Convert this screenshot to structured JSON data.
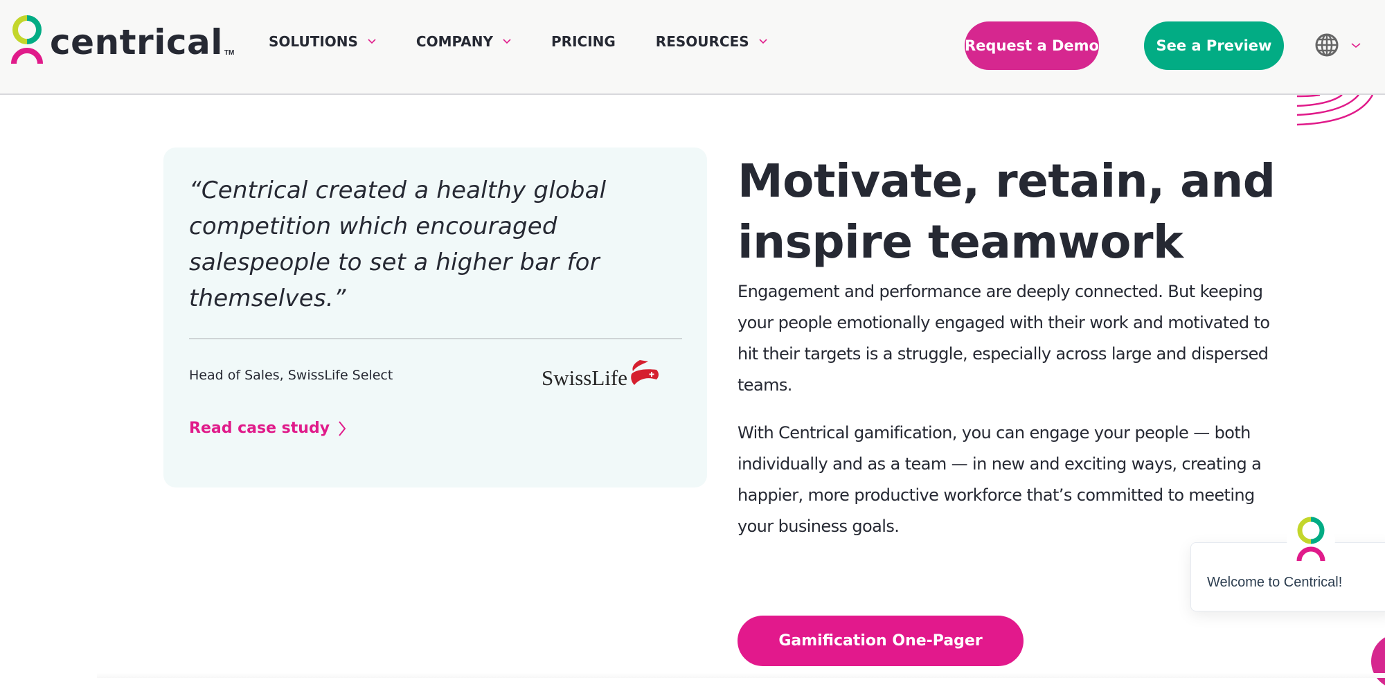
{
  "brand": {
    "name": "centrical",
    "trademark": "TM",
    "colors": {
      "pink": "#e01b8a",
      "green": "#02ac84",
      "lime": "#c3d62b",
      "dark": "#262933",
      "card_bg": "#f1f9f9"
    }
  },
  "nav": {
    "items": [
      {
        "label": "SOLUTIONS",
        "has_dropdown": true
      },
      {
        "label": "COMPANY",
        "has_dropdown": true
      },
      {
        "label": "PRICING",
        "has_dropdown": false
      },
      {
        "label": "RESOURCES",
        "has_dropdown": true
      }
    ],
    "request_demo_label": "Request a Demo",
    "see_preview_label": "See a Preview",
    "language_icon": "globe-icon"
  },
  "testimonial": {
    "quote": "“Centrical created a healthy global competition which encouraged salespeople to set a higher bar for themselves.”",
    "attribution": "Head of Sales, SwissLife Select",
    "company_logo_text": "SwissLife",
    "link_label": "Read case study"
  },
  "main": {
    "headline": "Motivate, retain, and inspire teamwork",
    "paragraphs": [
      "Engagement and performance are deeply connected. But keeping your people emotionally engaged with their work and motivated to hit their targets is a struggle, especially across large and dispersed teams.",
      "With Centrical gamification, you can engage your people — both individually and as a team — in new and exciting ways, creating a happier, more productive workforce that’s committed to meeting your business goals."
    ],
    "cta_label": "Gamification One-Pager"
  },
  "chat": {
    "welcome_text": "Welcome to Centrical!"
  }
}
